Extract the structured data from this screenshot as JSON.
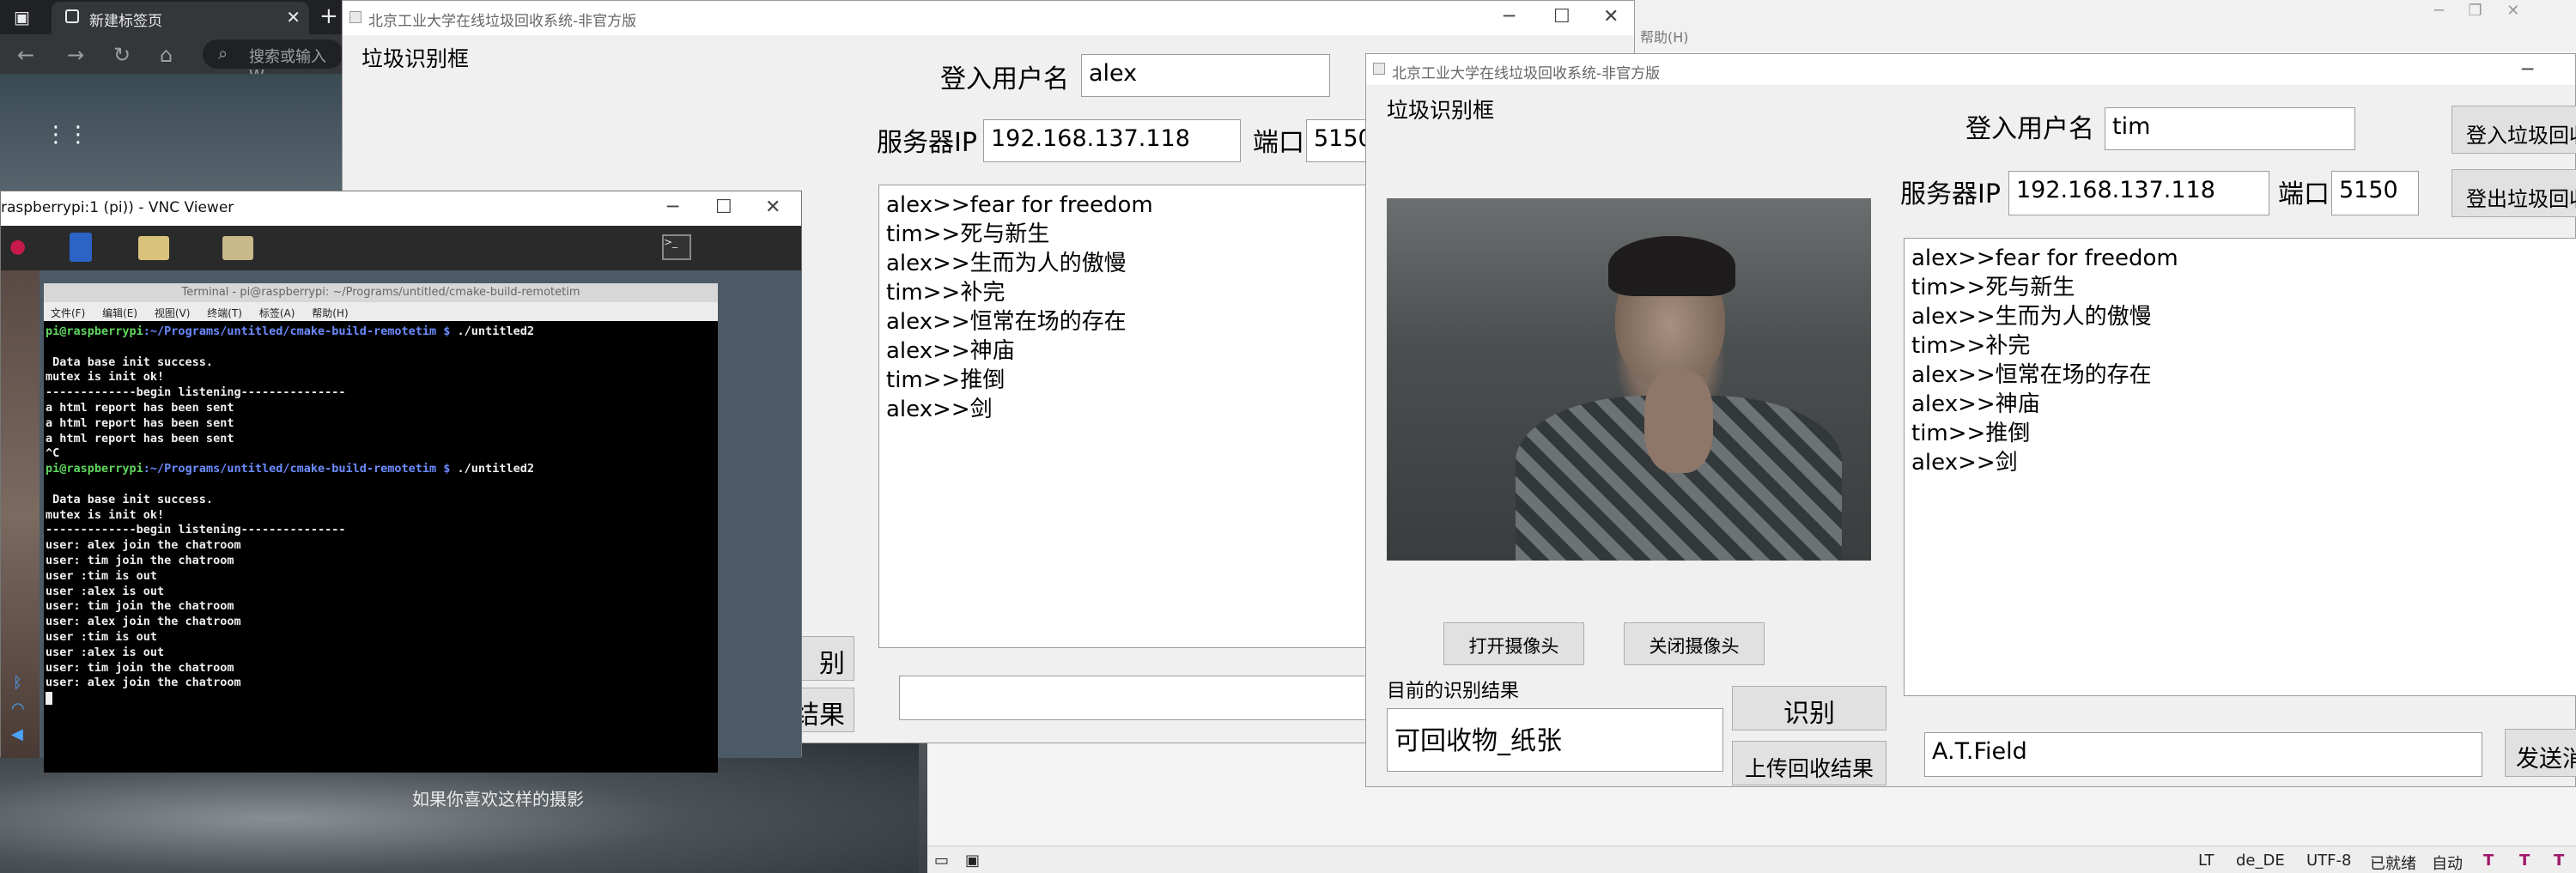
{
  "browser": {
    "tab_title": "新建标签页",
    "omnibox_placeholder": "搜索或输入 W"
  },
  "bg_app": {
    "menu_help": "帮助(H)",
    "status": {
      "lt": "LT",
      "lang": "de_DE",
      "encoding": "UTF-8",
      "ready": "已就绪",
      "auto": "自动"
    }
  },
  "wallpaper": {
    "caption": "如果你喜欢这样的摄影"
  },
  "win_alex": {
    "title": "北京工业大学在线垃圾回收系统-非官方版",
    "recog_frame_label": "垃圾识别框",
    "username_label": "登入用户名",
    "username_value": "alex",
    "server_ip_label": "服务器IP",
    "server_ip_value": "192.168.137.118",
    "port_label": "端口",
    "port_value": "5150",
    "chat": [
      "alex>>fear for freedom",
      "tim>>死与新生",
      "alex>>生而为人的傲慢",
      "tim>>补完",
      "alex>>恒常在场的存在",
      "alex>>神庙",
      "tim>>推倒",
      "alex>>剑"
    ],
    "btn_partial_1": "别",
    "btn_partial_2": "结果"
  },
  "vnc": {
    "title": "raspberrypi:1 (pi)) - VNC Viewer",
    "terminal_title": "Terminal - pi@raspberrypi: ~/Programs/untitled/cmake-build-remotetim",
    "terminal_menu": [
      "文件(F)",
      "编辑(E)",
      "视图(V)",
      "终端(T)",
      "标签(A)",
      "帮助(H)"
    ],
    "prompt_user": "pi@raspberrypi",
    "prompt_path": ":~/Programs/untitled/cmake-build-remotetim $",
    "command": " ./untitled2",
    "run1": [
      "",
      " Data base init success.",
      "mutex is init ok!",
      "-------------begin listening---------------",
      "a html report has been sent",
      "a html report has been sent",
      "a html report has been sent",
      "^C"
    ],
    "run2": [
      "",
      " Data base init success.",
      "mutex is init ok!",
      "-------------begin listening---------------",
      "user: alex join the chatroom",
      "user: tim join the chatroom",
      "user :tim is out",
      "user :alex is out",
      "user: tim join the chatroom",
      "user: alex join the chatroom",
      "user :tim is out",
      "user :alex is out",
      "user: tim join the chatroom",
      "user: alex join the chatroom"
    ]
  },
  "win_tim": {
    "title": "北京工业大学在线垃圾回收系统-非官方版",
    "recog_frame_label": "垃圾识别框",
    "open_camera": "打开摄像头",
    "close_camera": "关闭摄像头",
    "current_result_label": "目前的识别结果",
    "current_result_value": "可回收物_纸张",
    "recognize_button": "识别",
    "upload_button": "上传回收结果",
    "username_label": "登入用户名",
    "username_value": "tim",
    "login_button": "登入垃圾回收",
    "server_ip_label": "服务器IP",
    "server_ip_value": "192.168.137.118",
    "port_label": "端口",
    "port_value": "5150",
    "logout_button": "登出垃圾回收",
    "chat": [
      "alex>>fear for freedom",
      "tim>>死与新生",
      "alex>>生而为人的傲慢",
      "tim>>补完",
      "alex>>恒常在场的存在",
      "alex>>神庙",
      "tim>>推倒",
      "alex>>剑"
    ],
    "message_value": "A.T.Field",
    "send_button": "发送消"
  }
}
